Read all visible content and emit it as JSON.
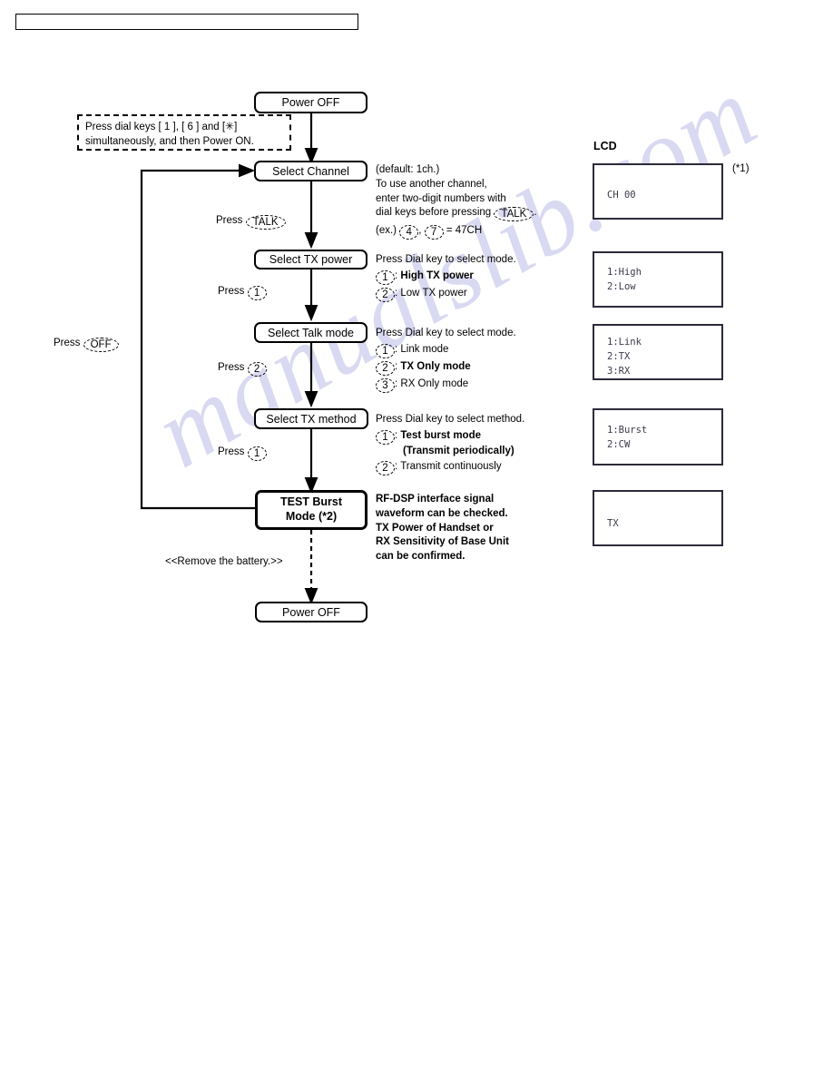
{
  "page": {
    "header_box_text": "",
    "watermark": "manualslib.com"
  },
  "flow": {
    "power_off_top": "Power OFF",
    "start_note": "Press dial keys [ 1 ], [ 6 ] and [✳]\nsimultaneously, and then Power ON.",
    "start_note_line1": "Press dial keys [ 1 ], [ 6 ] and [",
    "start_note_star": "✳",
    "start_note_line1_end": "]",
    "start_note_line2": "simultaneously, and then Power ON.",
    "select_channel": "Select Channel",
    "select_tx_power": "Select TX power",
    "select_talk_mode": "Select Talk mode",
    "select_tx_method": "Select TX method",
    "test_burst_mode_line1": "TEST Burst",
    "test_burst_mode_line2": "Mode (*2)",
    "power_off_bottom": "Power OFF",
    "remove_battery": "<<Remove the battery.>>"
  },
  "press_labels": {
    "press": "Press",
    "talk": "TALK",
    "one": "1",
    "two": "2",
    "off": "OFF"
  },
  "annotations": {
    "channel": {
      "line1": "(default: 1ch.)",
      "line2": "To use another channel,",
      "line3": "enter two-digit numbers with",
      "line4_pre": "dial keys before pressing",
      "line4_key": "TALK",
      "line4_post": ".",
      "line5_pre": "(ex.)",
      "line5_key1": "4",
      "line5_sep": ",",
      "line5_key2": "7",
      "line5_post": "= 47CH"
    },
    "tx_power": {
      "heading": "Press Dial key to select mode.",
      "items": [
        {
          "key": "1",
          "label": "High TX power",
          "bold": true
        },
        {
          "key": "2",
          "label": "Low TX power",
          "bold": false
        }
      ]
    },
    "talk_mode": {
      "heading": "Press Dial key to select mode.",
      "items": [
        {
          "key": "1",
          "label": "Link mode",
          "bold": false
        },
        {
          "key": "2",
          "label": "TX Only mode",
          "bold": true
        },
        {
          "key": "3",
          "label": "RX Only mode",
          "bold": false
        }
      ]
    },
    "tx_method": {
      "heading": "Press Dial key to select method.",
      "items": [
        {
          "key": "1",
          "label": "Test burst mode",
          "label2": "(Transmit periodically)",
          "bold": true
        },
        {
          "key": "2",
          "label": "Transmit continuously",
          "bold": false
        }
      ]
    },
    "burst": {
      "line1": "RF-DSP interface signal",
      "line2": "waveform can be checked.",
      "line3": "TX Power of Handset or",
      "line4": "RX Sensitivity of Base Unit",
      "line5": "can be confirmed."
    }
  },
  "lcd": {
    "title": "LCD",
    "footnote": "(*1)",
    "panels": [
      {
        "name": "channel",
        "lines": [
          "CH 00"
        ]
      },
      {
        "name": "tx-power",
        "lines": [
          "1:High",
          "2:Low"
        ]
      },
      {
        "name": "talk-mode",
        "lines": [
          "1:Link",
          "2:TX",
          "3:RX"
        ]
      },
      {
        "name": "tx-method",
        "lines": [
          "1:Burst",
          "2:CW"
        ]
      },
      {
        "name": "burst-status",
        "lines": [
          "TX"
        ]
      }
    ]
  },
  "colors": {
    "line": "#000000",
    "lcd_border": "#2b2b3a",
    "lcd_text": "#3a3a4a",
    "watermark": "#d9d9f2"
  }
}
